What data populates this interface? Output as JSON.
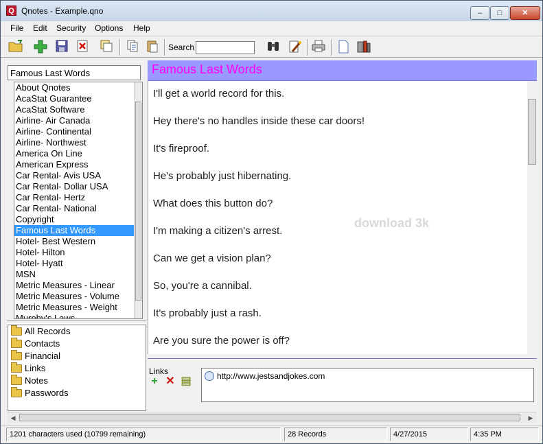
{
  "window": {
    "title": "Qnotes - Example.qno",
    "app_icon_letter": "Q",
    "minimize": "–",
    "maximize": "□",
    "close": "✕"
  },
  "menu": [
    "File",
    "Edit",
    "Security",
    "Options",
    "Help"
  ],
  "toolbar": {
    "search_label": "Search",
    "search_value": "",
    "buttons": [
      "open-folder-icon",
      "add-icon",
      "save-icon",
      "delete-icon",
      "copy-window-icon",
      "copy-icon",
      "paste-icon",
      "binoculars-icon",
      "edit-wand-icon",
      "printer-icon",
      "new-document-icon",
      "tools-icon"
    ]
  },
  "record_title_field": "Famous Last Words",
  "records": [
    "About Qnotes",
    "AcaStat Guarantee",
    "AcaStat Software",
    "Airline- Air Canada",
    "Airline- Continental",
    "Airline- Northwest",
    "America On Line",
    "American Express",
    "Car Rental- Avis USA",
    "Car Rental- Dollar USA",
    "Car Rental- Hertz",
    "Car Rental- National",
    "Copyright",
    "Famous Last Words",
    "Hotel- Best Western",
    "Hotel- Hilton",
    "Hotel- Hyatt",
    "MSN",
    "Metric Measures - Linear",
    "Metric Measures - Volume",
    "Metric Measures - Weight",
    "Murphy's Laws"
  ],
  "selected_record": "Famous Last Words",
  "categories": [
    "All Records",
    "Contacts",
    "Financial",
    "Links",
    "Notes",
    "Passwords"
  ],
  "note": {
    "title": "Famous Last Words",
    "lines": [
      "I'll get a world record for this.",
      "Hey there's no handles inside these car doors!",
      " It's fireproof.",
      " He's probably just hibernating.",
      " What does this button do?",
      " I'm making a citizen's arrest.",
      " Can we get a vision plan?",
      " So, you're a cannibal.",
      " It's probably just a rash.",
      " Are you sure the power is off?"
    ],
    "watermark": "download 3k"
  },
  "links": {
    "label": "Links",
    "add": "+",
    "remove": "✕",
    "edit": "▤",
    "items": [
      "http://www.jestsandjokes.com"
    ]
  },
  "status": {
    "chars": "1201 characters used (10799 remaining)",
    "records": "28 Records",
    "date": "4/27/2015",
    "time": "4:35 PM"
  },
  "colors": {
    "title_bar_bg": "#9999ff",
    "title_text": "#ff00ff",
    "selection": "#3399ff"
  }
}
